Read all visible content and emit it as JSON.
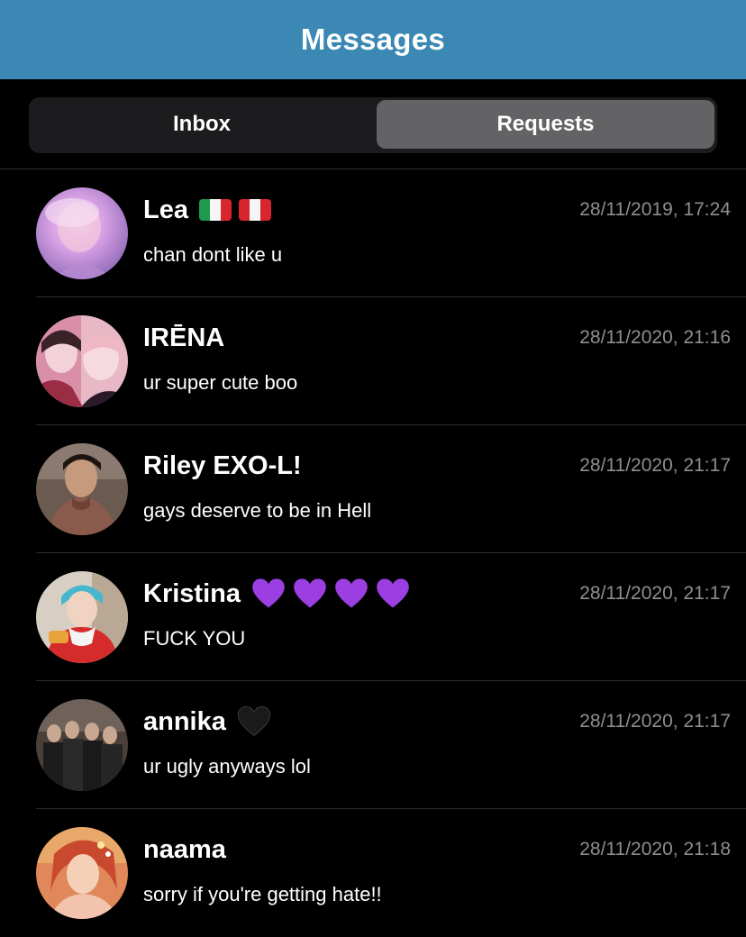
{
  "header": {
    "title": "Messages",
    "background": "#3a88b3"
  },
  "tabs": {
    "inbox": "Inbox",
    "requests": "Requests",
    "selected": "requests"
  },
  "conversations": [
    {
      "name": " Lea",
      "emojis": [
        "flag-italy-icon",
        "flag-peru-icon"
      ],
      "timestamp": "28/11/2019, 17:24",
      "preview": "chan dont like u"
    },
    {
      "name": " IRĒNA",
      "emojis": [],
      "timestamp": "28/11/2020, 21:16",
      "preview": "ur super cute boo"
    },
    {
      "name": "Riley EXO-L!",
      "emojis": [],
      "timestamp": "28/11/2020, 21:17",
      "preview": "gays deserve to be in Hell"
    },
    {
      "name": "Kristina",
      "emojis": [
        "purple-heart-icon",
        "purple-heart-icon",
        "purple-heart-icon",
        "purple-heart-icon"
      ],
      "timestamp": "28/11/2020, 21:17",
      "preview": "FUCK YOU"
    },
    {
      "name": "annika",
      "emojis": [
        "black-heart-icon"
      ],
      "timestamp": "28/11/2020, 21:17",
      "preview": "ur ugly anyways lol"
    },
    {
      "name": " naama",
      "emojis": [],
      "timestamp": "28/11/2020, 21:18",
      "preview": "sorry if you're getting hate!!"
    }
  ],
  "colors": {
    "purple_heart": "#9b3fe3",
    "black_heart": "#1a1a1a",
    "timestamp": "#8e8e93",
    "selected_tab": "#636366"
  }
}
